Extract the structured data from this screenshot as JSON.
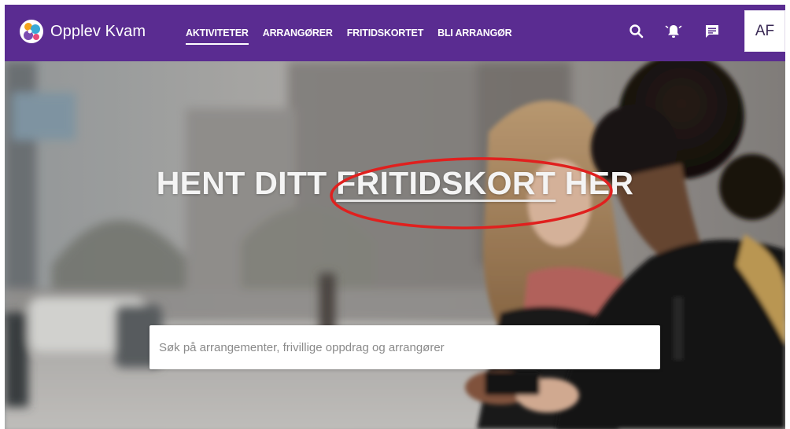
{
  "header": {
    "brand_name": "Opplev Kvam",
    "nav": [
      {
        "label": "AKTIVITETER",
        "active": true
      },
      {
        "label": "ARRANGØRER",
        "active": false
      },
      {
        "label": "FRITIDSKORTET",
        "active": false
      },
      {
        "label": "BLI ARRANGØR",
        "active": false
      }
    ],
    "icons": [
      "search-icon",
      "bell-icon",
      "chat-icon"
    ],
    "avatar_initials": "AF"
  },
  "hero": {
    "title_before": "HENT DITT ",
    "title_highlight": "FRITIDSKORT",
    "title_after": " HER",
    "search_placeholder": "Søk på arrangementer, frivillige oppdrag og arrangører"
  },
  "colors": {
    "header_bg": "#5a2c91",
    "annotation": "#e0201e"
  }
}
